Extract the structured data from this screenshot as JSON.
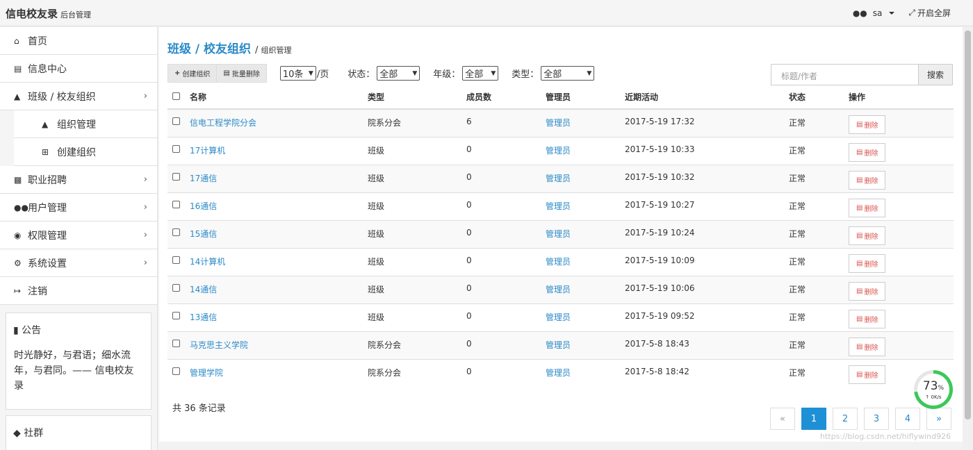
{
  "header": {
    "brand": "信电校友录",
    "brand_sub": "后台管理",
    "user": "sa",
    "fullscreen": "开启全屏"
  },
  "sidebar": {
    "items": [
      {
        "label": "首页",
        "icon": "home-icon"
      },
      {
        "label": "信息中心",
        "icon": "newspaper-icon"
      },
      {
        "label": "班级 / 校友组织",
        "icon": "graduation-cap-icon"
      },
      {
        "label": "组织管理",
        "icon": "bank-icon"
      },
      {
        "label": "创建组织",
        "icon": "plus-square-icon"
      },
      {
        "label": "职业招聘",
        "icon": "briefcase-icon"
      },
      {
        "label": "用户管理",
        "icon": "users-icon"
      },
      {
        "label": "权限管理",
        "icon": "eye-icon"
      },
      {
        "label": "系统设置",
        "icon": "cogs-icon"
      },
      {
        "label": "注销",
        "icon": "sign-out-icon"
      }
    ],
    "notice_title": "公告",
    "notice_body": "时光静好，与君语；细水流年，与君同。—— 信电校友录",
    "community_title": "社群"
  },
  "breadcrumb": {
    "section": "班级 / 校友组织",
    "leaf": "组织管理"
  },
  "toolbar": {
    "create": "创建组织",
    "batch_delete": "批量删除",
    "page_size": "10条",
    "per_page": "/页",
    "status_label": "状态：",
    "status_value": "全部",
    "grade_label": "年级：",
    "grade_value": "全部",
    "type_label": "类型：",
    "type_value": "全部"
  },
  "search": {
    "placeholder": "标题/作者",
    "button": "搜索"
  },
  "table": {
    "columns": [
      "名称",
      "类型",
      "成员数",
      "管理员",
      "近期活动",
      "状态",
      "操作"
    ],
    "delete_label": "删除",
    "rows": [
      {
        "name": "信电工程学院分会",
        "type": "院系分会",
        "members": "6",
        "admin": "管理员",
        "activity": "2017-5-19 17:32",
        "status": "正常"
      },
      {
        "name": "17计算机",
        "type": "班级",
        "members": "0",
        "admin": "管理员",
        "activity": "2017-5-19 10:33",
        "status": "正常"
      },
      {
        "name": "17通信",
        "type": "班级",
        "members": "0",
        "admin": "管理员",
        "activity": "2017-5-19 10:32",
        "status": "正常"
      },
      {
        "name": "16通信",
        "type": "班级",
        "members": "0",
        "admin": "管理员",
        "activity": "2017-5-19 10:27",
        "status": "正常"
      },
      {
        "name": "15通信",
        "type": "班级",
        "members": "0",
        "admin": "管理员",
        "activity": "2017-5-19 10:24",
        "status": "正常"
      },
      {
        "name": "14计算机",
        "type": "班级",
        "members": "0",
        "admin": "管理员",
        "activity": "2017-5-19 10:09",
        "status": "正常"
      },
      {
        "name": "14通信",
        "type": "班级",
        "members": "0",
        "admin": "管理员",
        "activity": "2017-5-19 10:06",
        "status": "正常"
      },
      {
        "name": "13通信",
        "type": "班级",
        "members": "0",
        "admin": "管理员",
        "activity": "2017-5-19 09:52",
        "status": "正常"
      },
      {
        "name": "马克思主义学院",
        "type": "院系分会",
        "members": "0",
        "admin": "管理员",
        "activity": "2017-5-8 18:43",
        "status": "正常"
      },
      {
        "name": "管理学院",
        "type": "院系分会",
        "members": "0",
        "admin": "管理员",
        "activity": "2017-5-8 18:42",
        "status": "正常"
      }
    ]
  },
  "footer": {
    "total": "共 36 条记录"
  },
  "pagination": {
    "prev": "«",
    "pages": [
      "1",
      "2",
      "3",
      "4"
    ],
    "next": "»",
    "active": "1"
  },
  "speed_widget": {
    "percent": "73",
    "percent_sign": "%",
    "rate": "↑ 0K/s"
  },
  "watermark": "https://blog.csdn.net/hiflywind926",
  "colors": {
    "link": "#2a8ac8",
    "active_page": "#1e90d6",
    "danger": "#d9534f",
    "gauge": "#3cc85a"
  }
}
